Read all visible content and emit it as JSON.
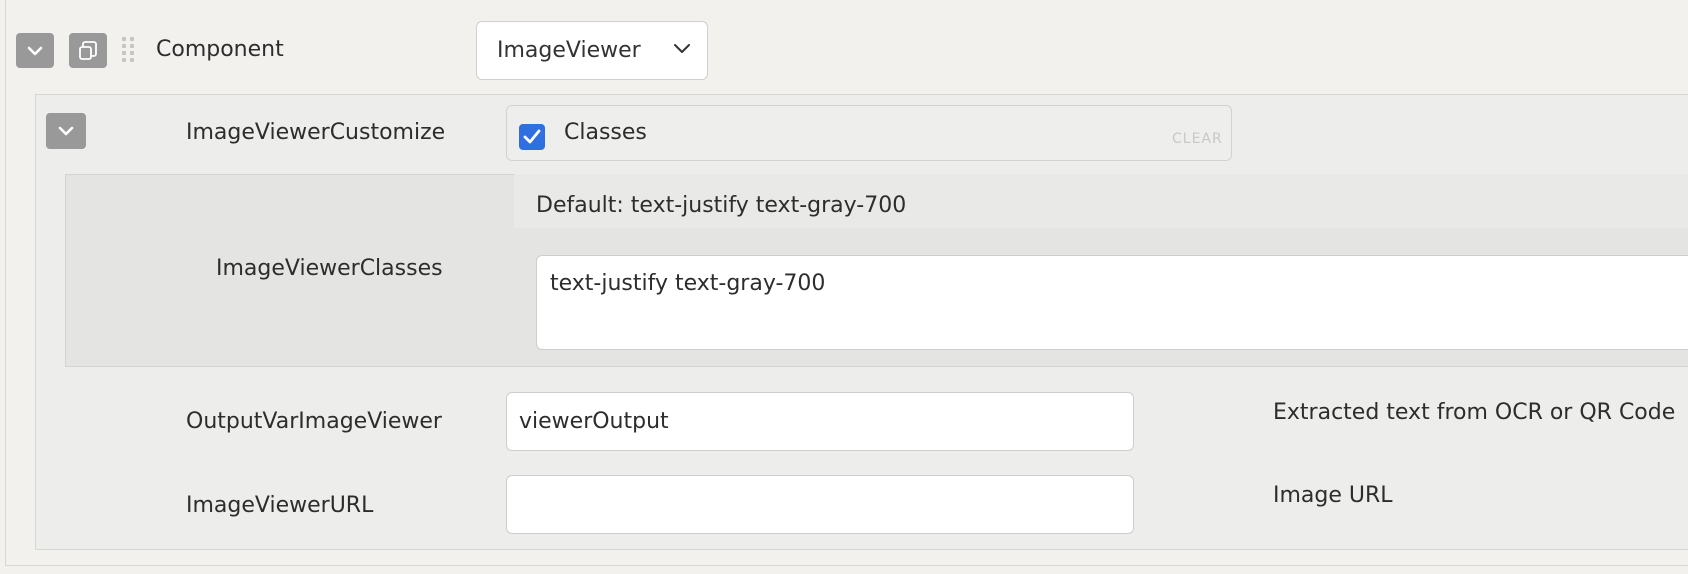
{
  "component": {
    "label": "Component",
    "selected": "ImageViewer"
  },
  "customize": {
    "label": "ImageViewerCustomize",
    "checkbox_label": "Classes",
    "checked": true,
    "clear_label": "CLEAR"
  },
  "classes": {
    "label": "ImageViewerClasses",
    "default_text": "Default: text-justify text-gray-700",
    "value": "text-justify text-gray-700"
  },
  "output_var": {
    "label": "OutputVarImageViewer",
    "value": "viewerOutput",
    "help": "Extracted text from OCR or QR Code"
  },
  "url": {
    "label": "ImageViewerURL",
    "value": "",
    "help": "Image URL"
  },
  "icons": {
    "collapse": "chevron-down-icon",
    "duplicate": "copy-icon",
    "drag": "drag-handle-icon",
    "check": "checkmark-icon"
  },
  "colors": {
    "icon_button": "#999999",
    "checkbox": "#2f6fe0",
    "background": "#f2f1ee"
  }
}
